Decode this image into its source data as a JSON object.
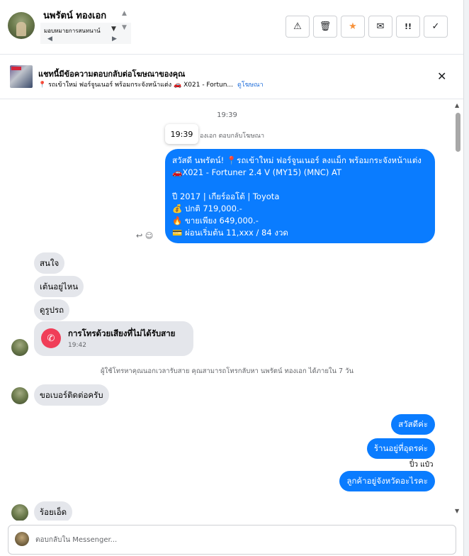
{
  "header": {
    "contact_name": "นพรัตน์ ทองเอก",
    "assign_label": "มอบหมายการสนทนาน์",
    "actions": [
      {
        "name": "report-button",
        "icon": "⚠"
      },
      {
        "name": "delete-button",
        "icon": "🗑"
      },
      {
        "name": "star-button",
        "icon": "★"
      },
      {
        "name": "mark-unread-button",
        "icon": "✉"
      },
      {
        "name": "spam-button",
        "icon": "!!"
      },
      {
        "name": "done-button",
        "icon": "✓"
      }
    ]
  },
  "ad_banner": {
    "title": "แชทนี้มีข้อความตอบกลับต่อโฆษณาของคุณ",
    "subtitle": "📍 รถเข้าใหม่ ฟอร์จูนเนอร์ พร้อมกระจังหน้าแต่ง 🚗 X021 - Fortun...",
    "link_label": "ดูโฆษณา"
  },
  "messages": {
    "timestamp_top": "19:39",
    "tooltip_time": "19:39",
    "reply_note": "องเอก ตอบกลับโฆษณา",
    "ad_reply_lines": [
      "สวัสดี นพรัตน์! 📍รถเข้าใหม่ ฟอร์จูนเนอร์ ลงแม็ก พร้อมกระจังหน้าแต่ง",
      "🚗X021 - Fortuner 2.4 V (MY15) (MNC) AT",
      "",
      "ปี 2017 | เกียร์ออโต้ | Toyota",
      "💰 ปกติ 719,000.-",
      "🔥 ขายเพียง 649,000.-",
      "💳 ผ่อนเริ่มต้น 11,xxx / 84 งวด"
    ],
    "incoming": [
      "สนใจ",
      "เต้นอยู่ไหน",
      "ดูรูปรถ"
    ],
    "missed_call_title": "การโทรด้วยเสียงที่ไม่ได้รับสาย",
    "missed_call_time": "19:42",
    "system_note": "ผู้ใช้โทรหาคุณนอกเวลารับสาย คุณสามารถโทรกลับหา นพรัตน์ ทองเอก ได้ภายใน 7 วัน",
    "incoming_2": "ขอเบอร์ติดต่อครับ",
    "outgoing": [
      "สวัสดีค่ะ",
      "ร้านอยู่ที่อุดรค่ะ"
    ],
    "read_by": "ปิ๋ว แป๋ว",
    "outgoing_2": "ลูกค้าอยู่จังหวัดอะไรคะ",
    "incoming_3": "ร้อยเอ็ด"
  },
  "composer": {
    "placeholder": "ตอบกลับใน Messenger..."
  }
}
